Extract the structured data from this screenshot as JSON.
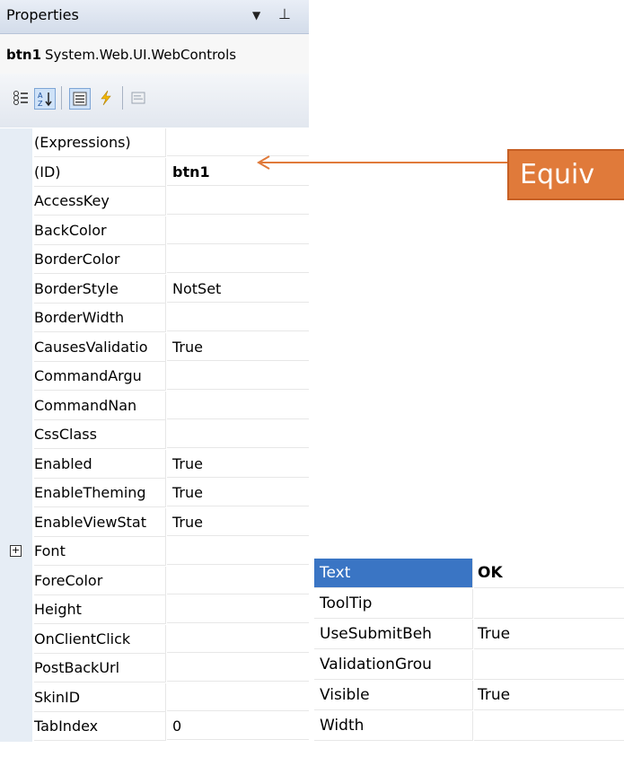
{
  "window": {
    "title": "Properties",
    "dropdown_icon": "triangle-down-icon",
    "pin_icon": "pin-icon"
  },
  "object": {
    "name": "btn1",
    "type": "System.Web.UI.WebControls"
  },
  "toolbar": [
    {
      "name": "categorized-button",
      "icon": "categorized-icon"
    },
    {
      "name": "alphabetical-button",
      "icon": "sort-az-icon",
      "active": true
    },
    {
      "name": "properties-button",
      "icon": "properties-icon",
      "active": true
    },
    {
      "name": "events-button",
      "icon": "lightning-icon"
    },
    {
      "name": "property-pages-button",
      "icon": "property-pages-icon"
    }
  ],
  "properties": [
    {
      "name": "(Expressions)",
      "value": ""
    },
    {
      "name": "(ID)",
      "value": "btn1",
      "bold": true
    },
    {
      "name": "AccessKey",
      "value": ""
    },
    {
      "name": "BackColor",
      "value": ""
    },
    {
      "name": "BorderColor",
      "value": ""
    },
    {
      "name": "BorderStyle",
      "value": "NotSet"
    },
    {
      "name": "BorderWidth",
      "value": ""
    },
    {
      "name": "CausesValidatio",
      "value": "True"
    },
    {
      "name": "CommandArgu",
      "value": ""
    },
    {
      "name": "CommandNan",
      "value": ""
    },
    {
      "name": "CssClass",
      "value": ""
    },
    {
      "name": "Enabled",
      "value": "True"
    },
    {
      "name": "EnableTheming",
      "value": "True"
    },
    {
      "name": "EnableViewStat",
      "value": "True"
    },
    {
      "name": "Font",
      "value": "",
      "expandable": true
    },
    {
      "name": "ForeColor",
      "value": ""
    },
    {
      "name": "Height",
      "value": ""
    },
    {
      "name": "OnClientClick",
      "value": ""
    },
    {
      "name": "PostBackUrl",
      "value": ""
    },
    {
      "name": "SkinID",
      "value": ""
    },
    {
      "name": "TabIndex",
      "value": "0"
    }
  ],
  "callout": {
    "text": "Equiv",
    "color": "#e07a3a"
  },
  "properties2": [
    {
      "name": "Text",
      "value": "OK",
      "selected": true
    },
    {
      "name": "ToolTip",
      "value": ""
    },
    {
      "name": "UseSubmitBeh",
      "value": "True"
    },
    {
      "name": "ValidationGrou",
      "value": ""
    },
    {
      "name": "Visible",
      "value": "True"
    },
    {
      "name": "Width",
      "value": ""
    }
  ]
}
